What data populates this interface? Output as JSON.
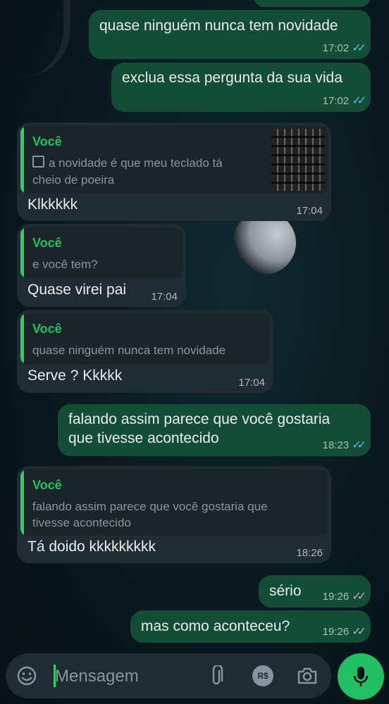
{
  "messages": [
    {
      "text": "quase ninguém nunca tem novidade",
      "time": "17:02",
      "status": "read"
    },
    {
      "text": "exclua essa pergunta da sua vida",
      "time": "17:02",
      "status": "read"
    },
    {
      "quote_author": "Você",
      "quote_lines": [
        "a novidade é que meu teclado tá",
        "cheio de poeira"
      ],
      "quote_has_image": true,
      "text": "Klkkkkk",
      "time": "17:04"
    },
    {
      "quote_author": "Você",
      "quote_lines": [
        "e você tem?"
      ],
      "text": "Quase virei pai",
      "time": "17:04"
    },
    {
      "quote_author": "Você",
      "quote_lines": [
        "quase ninguém nunca tem novidade"
      ],
      "text": "Serve ? Kkkkk",
      "time": "17:04"
    },
    {
      "text_lines": [
        "falando assim parece que você gostaria",
        "que tivesse acontecido"
      ],
      "time": "18:23",
      "status": "read"
    },
    {
      "quote_author": "Você",
      "quote_lines": [
        "falando assim parece que você gostaria que",
        "tivesse acontecido"
      ],
      "text": "Tá doido kkkkkkkkk",
      "time": "18:26"
    },
    {
      "text": "sério",
      "time": "19:26",
      "status": "delivered"
    },
    {
      "text": "mas como aconteceu?",
      "time": "19:26",
      "status": "delivered"
    }
  ],
  "input": {
    "placeholder": "Mensagem"
  },
  "icons": {
    "emoji": "emoji-icon",
    "attach": "paperclip-icon",
    "payment": "real-currency-icon",
    "camera": "camera-icon",
    "mic": "microphone-icon"
  },
  "colors": {
    "outgoing": "#144d37",
    "incoming": "#202c33",
    "accent": "#25d366",
    "read_ticks": "#53bdeb"
  }
}
